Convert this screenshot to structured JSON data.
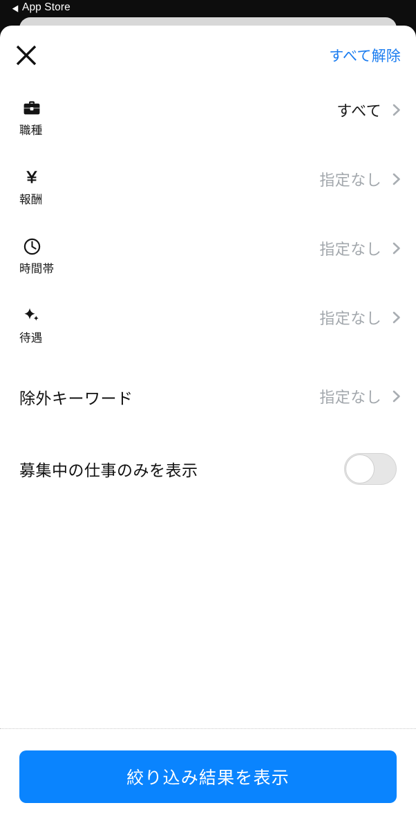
{
  "status_bar": {
    "back_arrow": "◀",
    "back_label": "App Store"
  },
  "sheet": {
    "header": {
      "close_icon": "close-x-icon",
      "clear_all_label": "すべて解除"
    },
    "filter_rows": [
      {
        "icon": "briefcase-icon",
        "label": "職種",
        "value": "すべて",
        "value_state": "selected",
        "chevron": "chevron-right-icon"
      },
      {
        "icon": "yen-icon",
        "label": "報酬",
        "value": "指定なし",
        "value_state": "unset",
        "chevron": "chevron-right-icon"
      },
      {
        "icon": "clock-icon",
        "label": "時間帯",
        "value": "指定なし",
        "value_state": "unset",
        "chevron": "chevron-right-icon"
      },
      {
        "icon": "sparkle-icon",
        "label": "待遇",
        "value": "指定なし",
        "value_state": "unset",
        "chevron": "chevron-right-icon"
      },
      {
        "icon": null,
        "label": "除外キーワード",
        "value": "指定なし",
        "value_state": "unset",
        "chevron": "chevron-right-icon"
      }
    ],
    "toggle_row": {
      "label": "募集中の仕事のみを表示",
      "state": "off"
    },
    "footer": {
      "submit_label": "絞り込み結果を表示"
    }
  },
  "colors": {
    "accent_blue": "#0a84fe",
    "link_blue": "#1a7cf0",
    "value_muted": "#a3a8ad",
    "text_dark": "#1a1a1a",
    "toggle_track_off": "#e6e6e6",
    "status_bar_bg": "#0d0d0d"
  }
}
